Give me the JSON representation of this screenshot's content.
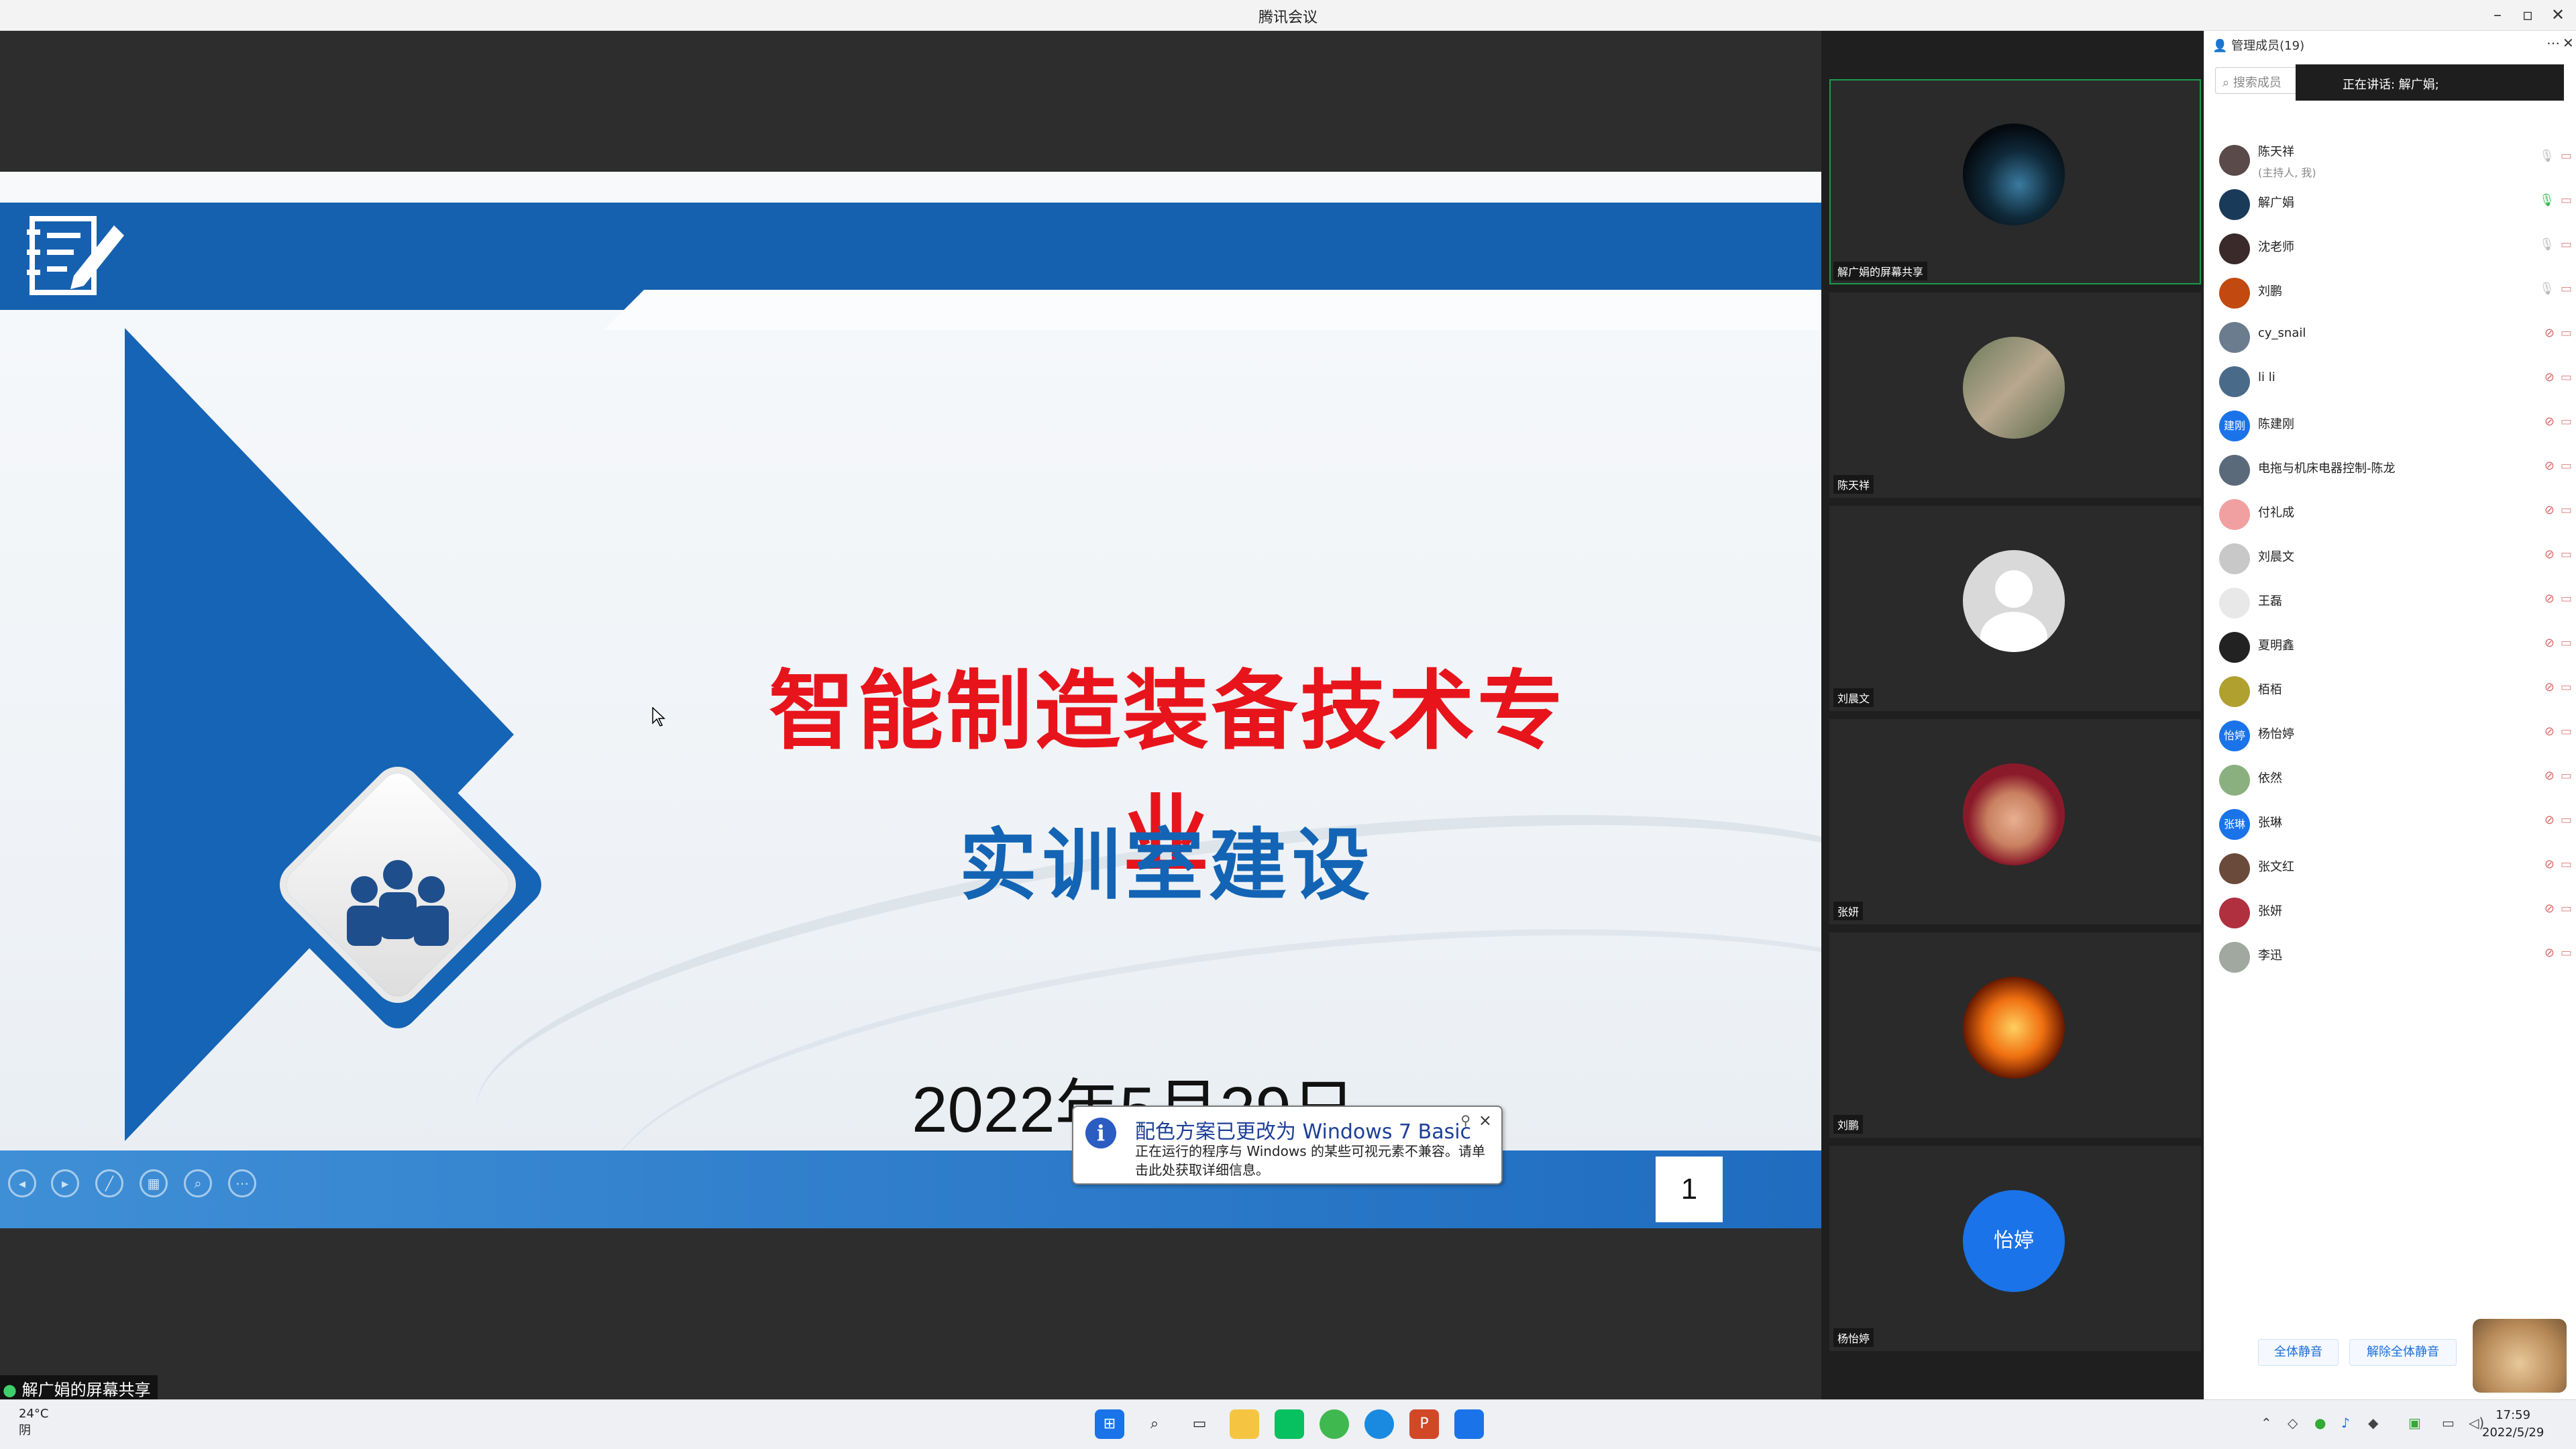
{
  "window": {
    "title": "腾讯会议"
  },
  "slide": {
    "headline": "智能制造装备技术专业",
    "subhead": "实训室建设",
    "date": "2022年5月29日",
    "page_number": "1"
  },
  "notification": {
    "title": "配色方案已更改为 Windows 7 Basic",
    "body": "正在运行的程序与 Windows 的某些可视元素不兼容。请单击此处获取详细信息。"
  },
  "sharer_label": "解广娟的屏幕共享",
  "video_tiles": [
    {
      "name": "解广娟的屏幕共享",
      "avatar": "planet"
    },
    {
      "name": "陈天祥",
      "avatar": "photo-person"
    },
    {
      "name": "刘晨文",
      "avatar": "default"
    },
    {
      "name": "张妍",
      "avatar": "cartoon-woman"
    },
    {
      "name": "刘鹏",
      "avatar": "phoenix"
    },
    {
      "name": "杨怡婷",
      "avatar": "text",
      "avatar_text": "怡婷"
    }
  ],
  "panel": {
    "header": "管理成员(19)",
    "search_placeholder": "搜索成员",
    "speaking": "正在讲话: 解广娟;",
    "members": [
      {
        "name": "陈天祥",
        "sub": "(主持人, 我)",
        "color": "#5a4a4a"
      },
      {
        "name": "解广娟",
        "sub": "",
        "color": "#1a3a5a"
      },
      {
        "name": "沈老师",
        "sub": "",
        "color": "#3a2a2a"
      },
      {
        "name": "刘鹏",
        "sub": "",
        "color": "#c24a10"
      },
      {
        "name": "cy_snail",
        "sub": "",
        "color": "#6b7c8e"
      },
      {
        "name": "li li",
        "sub": "",
        "color": "#4a6a8a"
      },
      {
        "name": "陈建刚",
        "sub": "",
        "color": "#1a73e8",
        "text": "建刚"
      },
      {
        "name": "电拖与机床电器控制-陈龙",
        "sub": "",
        "color": "#5a6a7a"
      },
      {
        "name": "付礼成",
        "sub": "",
        "color": "#f0a0a0"
      },
      {
        "name": "刘晨文",
        "sub": "",
        "color": "#c8c8c8"
      },
      {
        "name": "王磊",
        "sub": "",
        "color": "#e8e8e8"
      },
      {
        "name": "夏明鑫",
        "sub": "",
        "color": "#222222"
      },
      {
        "name": "栢栢",
        "sub": "",
        "color": "#b0a030"
      },
      {
        "name": "杨怡婷",
        "sub": "",
        "color": "#1a73e8",
        "text": "怡婷"
      },
      {
        "name": "依然",
        "sub": "",
        "color": "#8ab080"
      },
      {
        "name": "张琳",
        "sub": "",
        "color": "#1a73e8",
        "text": "张琳"
      },
      {
        "name": "张文红",
        "sub": "",
        "color": "#6a4a3a"
      },
      {
        "name": "张妍",
        "sub": "",
        "color": "#b03040"
      },
      {
        "name": "李迅",
        "sub": "",
        "color": "#a0a8a0"
      }
    ],
    "mute_all": "全体静音",
    "unmute_all": "解除全体静音"
  },
  "taskbar": {
    "temperature": "24°C",
    "weather": "阴",
    "time": "17:59",
    "date": "2022/5/29"
  }
}
